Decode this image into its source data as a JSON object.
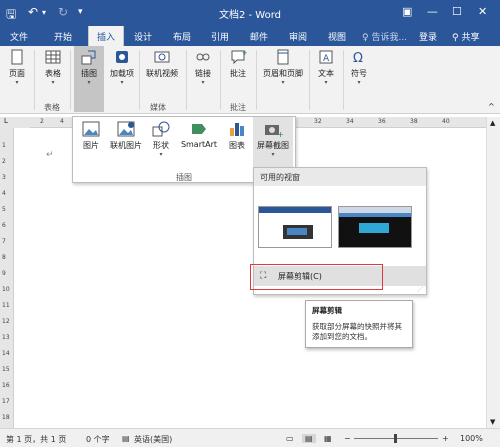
{
  "window": {
    "title": "文档2 - Word"
  },
  "tabs": [
    {
      "label": "文件"
    },
    {
      "label": "开始"
    },
    {
      "label": "插入"
    },
    {
      "label": "设计"
    },
    {
      "label": "布局"
    },
    {
      "label": "引用"
    },
    {
      "label": "邮件"
    },
    {
      "label": "审阅"
    },
    {
      "label": "视图"
    }
  ],
  "tellme": "♀ 告诉我...",
  "signin": "登录",
  "share": "共享",
  "ribbon": {
    "page_label": "页面",
    "table_label": "表格",
    "illustrations_label": "插图",
    "addins_label": "加载项",
    "online_video_label": "联机视频",
    "links_label": "链接",
    "comment_label": "批注",
    "header_footer_label": "页眉和页脚",
    "text_label": "文本",
    "symbols_label": "符号",
    "groups": {
      "tables": "表格",
      "media": "媒体",
      "comments": "批注"
    }
  },
  "illustrations_popup": {
    "items": [
      {
        "label": "图片"
      },
      {
        "label": "联机图片"
      },
      {
        "label": "形状"
      },
      {
        "label": "SmartArt"
      },
      {
        "label": "图表"
      },
      {
        "label": "屏幕截图"
      }
    ],
    "group_label": "插图"
  },
  "screenshot_popup": {
    "header": "可用的视窗",
    "clip_label": "屏幕剪辑(C)"
  },
  "tooltip": {
    "title": "屏幕剪辑",
    "desc": "获取部分屏幕的快照并将其添加到您的文档。"
  },
  "ruler": {
    "corner": "L",
    "h_ticks": [
      "2",
      "4",
      "32",
      "34",
      "36",
      "38",
      "40"
    ],
    "v_ticks": [
      "1",
      "2",
      "3",
      "4",
      "5",
      "6",
      "7",
      "8",
      "9",
      "10",
      "11",
      "12",
      "13",
      "14",
      "15",
      "16",
      "17",
      "18"
    ]
  },
  "status": {
    "page": "第 1 页，共 1 页",
    "words": "0 个字",
    "lang": "英语(美国)",
    "zoom": "100%"
  },
  "colors": {
    "accent": "#2b579a",
    "highlight": "#e0393b"
  }
}
